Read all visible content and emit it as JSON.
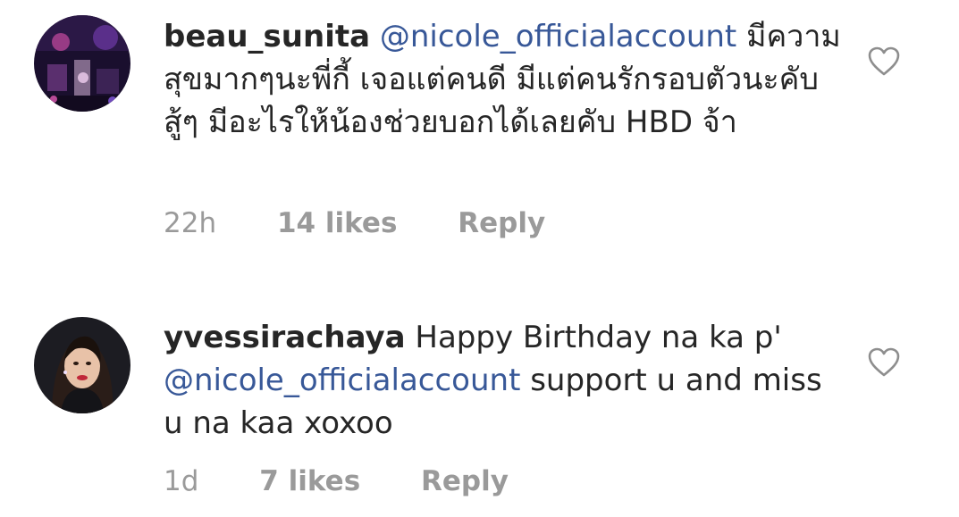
{
  "comments": [
    {
      "username": "beau_sunita",
      "mention": "@nicole_officialaccount",
      "text": " มีความสุขมากๆนะพี่กี้ เจอแต่คนดี มีแต่คนรักรอบตัวนะคับ สู้ๆ มีอะไรให้น้องช่วยบอกได้เลยคับ HBD จ้า",
      "time": "22h",
      "likes": "14 likes",
      "reply": "Reply",
      "avatar_icon": "concert-photo-avatar"
    },
    {
      "username": "yvessirachaya",
      "text_before": " Happy Birthday na ka p'",
      "mention": "@nicole_officialaccount",
      "text_after": " support u and miss u na kaa  xoxoo",
      "time": "1d",
      "likes": "7 likes",
      "reply": "Reply",
      "avatar_icon": "portrait-photo-avatar"
    }
  ],
  "colors": {
    "text": "#262626",
    "mention": "#385898",
    "meta": "#9a9a9a"
  }
}
